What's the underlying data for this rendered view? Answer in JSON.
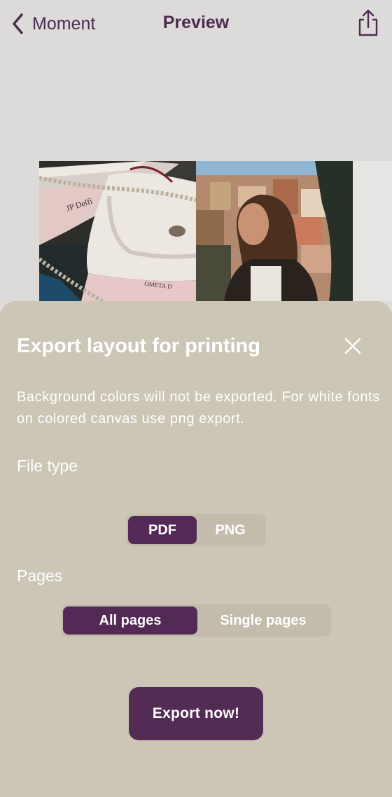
{
  "nav": {
    "back_label": "Moment",
    "title": "Preview"
  },
  "preview": {
    "photos": [
      {
        "name": "boats-photo",
        "boat_lettering_1": "JP Delfi",
        "boat_lettering_2": "OMETA D"
      },
      {
        "name": "woman-photo"
      }
    ]
  },
  "sheet": {
    "title": "Export layout for printing",
    "description": "Background colors will not be exported. For white fonts on colored canvas use png export.",
    "file_type": {
      "label": "File type",
      "options": [
        "PDF",
        "PNG"
      ],
      "selected": "PDF"
    },
    "pages": {
      "label": "Pages",
      "options": [
        "All pages",
        "Single pages"
      ],
      "selected": "All pages"
    },
    "export_label": "Export now!"
  },
  "colors": {
    "accent": "#522a55",
    "sheet_bg": "#ccc6b6",
    "screen_bg": "#dddbd9",
    "segment_bg": "#c3bcac"
  },
  "icons": {
    "back": "chevron-left-icon",
    "share": "share-icon",
    "close": "close-icon"
  }
}
